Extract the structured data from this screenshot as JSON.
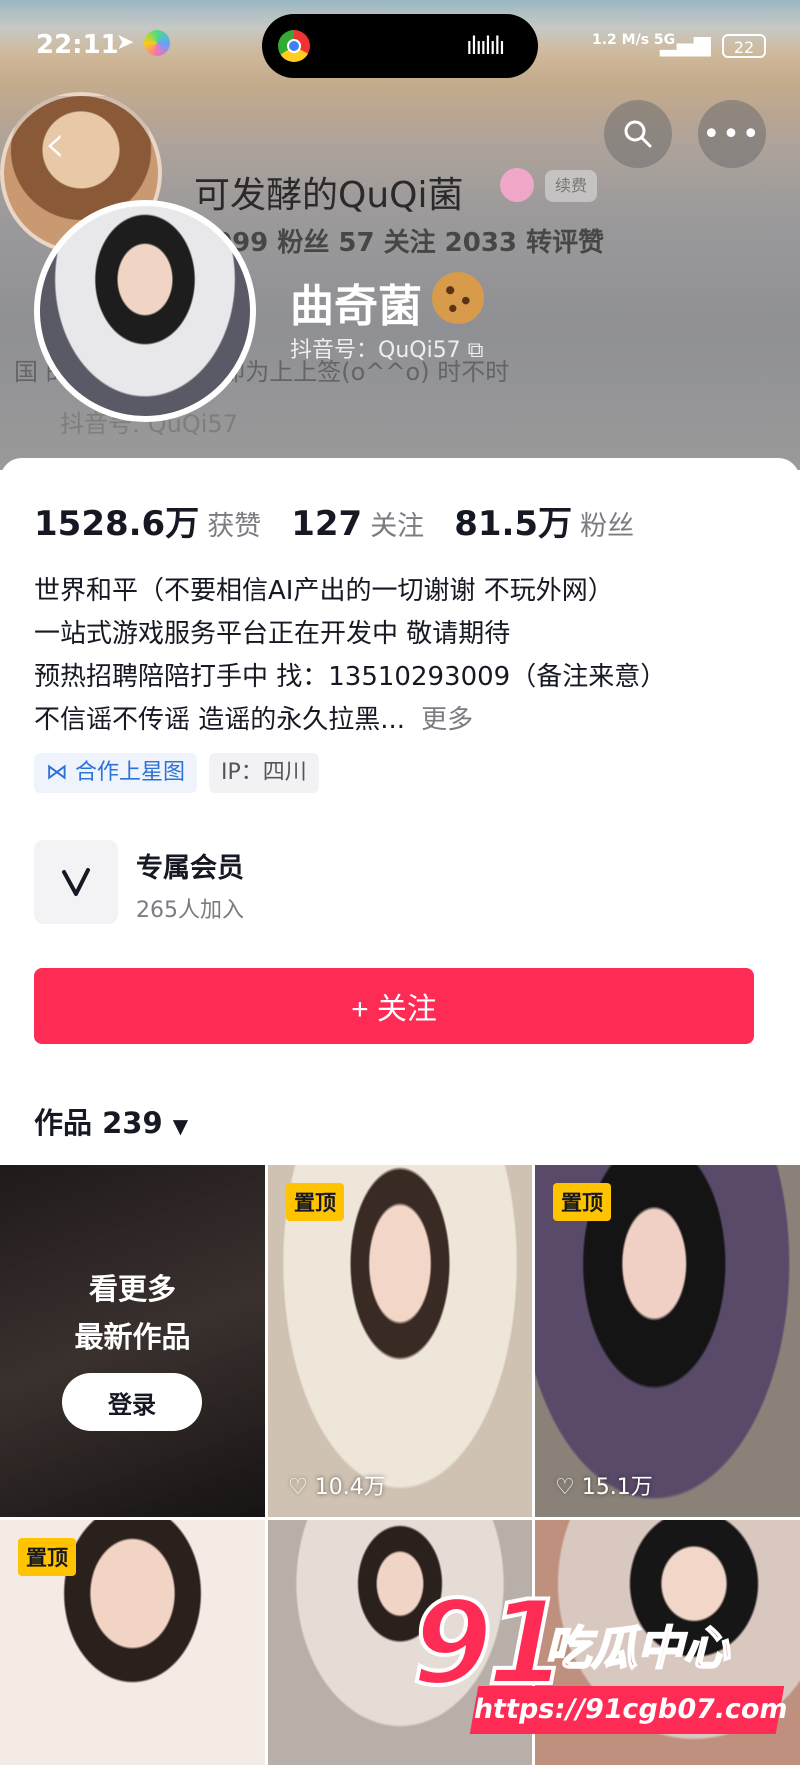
{
  "status_bar": {
    "time": "22:11",
    "network": "1.2 M/s 5G",
    "battery": "22"
  },
  "header": {
    "ghost_title": "可发酵的QuQi菌",
    "ghost_badge": "续费",
    "ghost_stats": "099 粉丝    57 关注    2033 转评赞",
    "ghost_bio": "国 的微博空间 相遇即为上上签(o^^o) 时不时",
    "ghost_line2": "抖音号: QuQi57",
    "name": "曲奇菌",
    "douyin_id": "抖音号：QuQi57"
  },
  "stats": [
    {
      "value": "1528.6万",
      "label": "获赞"
    },
    {
      "value": "127",
      "label": "关注"
    },
    {
      "value": "81.5万",
      "label": "粉丝"
    }
  ],
  "bio": {
    "lines": [
      "世界和平（不要相信AI产出的一切谢谢 不玩外网）",
      "一站式游戏服务平台正在开发中 敬请期待",
      "预热招聘陪陪打手中 找：13510293009（备注来意）",
      "不信谣不传谣 造谣的永久拉黑..."
    ],
    "more": "更多"
  },
  "tags": {
    "star": "合作上星图",
    "ip": "IP：四川"
  },
  "member": {
    "title": "专属会员",
    "subtitle": "265人加入"
  },
  "follow_button": "+ 关注",
  "works": {
    "label": "作品 239"
  },
  "grid": {
    "see_more": "看更多",
    "latest": "最新作品",
    "login": "登录",
    "pinned": "置顶",
    "likes": [
      "10.4万",
      "15.1万"
    ]
  },
  "watermark": {
    "num": "91",
    "cn": "吃瓜中心",
    "url": "https://91cgb07.com"
  },
  "colors": {
    "accent": "#fe2c55",
    "pin": "#ffc300"
  }
}
